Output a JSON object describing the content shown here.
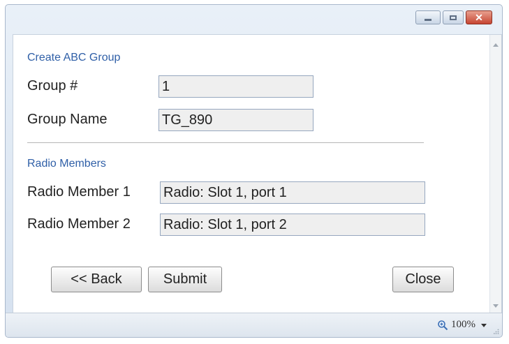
{
  "window": {
    "controls": {
      "minimize_icon": "minimize-icon",
      "maximize_icon": "maximize-icon",
      "close_glyph": "✕"
    }
  },
  "group_section": {
    "title": "Create ABC Group",
    "group_number": {
      "label": "Group #",
      "value": "1"
    },
    "group_name": {
      "label": "Group Name",
      "value": "TG_890"
    }
  },
  "radio_section": {
    "title": "Radio Members",
    "members": [
      {
        "label": "Radio Member 1",
        "value": "Radio: Slot 1, port 1"
      },
      {
        "label": "Radio Member 2",
        "value": "Radio: Slot 1, port 2"
      }
    ]
  },
  "buttons": {
    "back": "<< Back",
    "submit": "Submit",
    "close": "Close"
  },
  "statusbar": {
    "zoom": "100%"
  },
  "colors": {
    "section_title": "#2f5fa7",
    "field_bg": "#efefef",
    "close_button": "#c64532"
  }
}
